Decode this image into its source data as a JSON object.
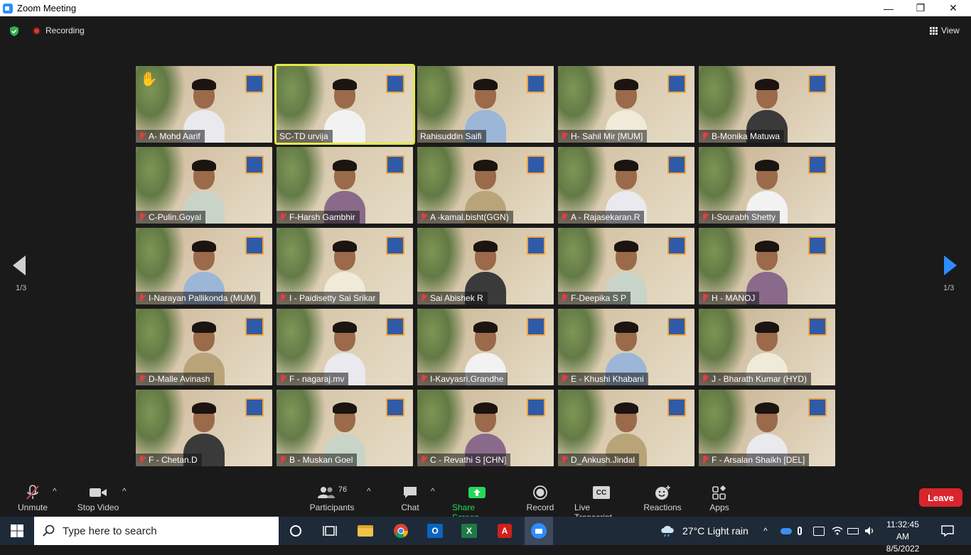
{
  "window": {
    "title": "Zoom Meeting",
    "minimize": "—",
    "restore": "❐",
    "close": "✕"
  },
  "meeting": {
    "recording_label": "Recording",
    "view_label": "View"
  },
  "pagination": {
    "left_page": "1/3",
    "right_page": "1/3"
  },
  "participants": [
    {
      "name": "A- Mohd Aarif",
      "muted": true,
      "raised_hand": true
    },
    {
      "name": "SC-TD urvija",
      "muted": false,
      "active_speaker": true
    },
    {
      "name": "Rahisuddin Saifi",
      "muted": false
    },
    {
      "name": "H- Sahil Mir [MUM]",
      "muted": true
    },
    {
      "name": "B-Monika Matuwa",
      "muted": true
    },
    {
      "name": "C-Pulin.Goyal",
      "muted": true
    },
    {
      "name": "F-Harsh Gambhir",
      "muted": true
    },
    {
      "name": "A -kamal.bisht(GGN)",
      "muted": true
    },
    {
      "name": "A - Rajasekaran.R",
      "muted": true
    },
    {
      "name": "I-Sourabh Shetty",
      "muted": true
    },
    {
      "name": "I-Narayan Pallikonda (MUM)",
      "muted": true
    },
    {
      "name": "I - Paidisetty Sai Srikar",
      "muted": true
    },
    {
      "name": "Sai Abishek R",
      "muted": true
    },
    {
      "name": "F-Deepika S P",
      "muted": true
    },
    {
      "name": "H - MANOJ",
      "muted": true
    },
    {
      "name": "D-Malle Avinash",
      "muted": true
    },
    {
      "name": "F - nagaraj.mv",
      "muted": true
    },
    {
      "name": "I-Kavyasri.Grandhe",
      "muted": true
    },
    {
      "name": "E - Khushi Khabani",
      "muted": true
    },
    {
      "name": "J - Bharath Kumar (HYD)",
      "muted": true
    },
    {
      "name": "F - Chetan.D",
      "muted": true
    },
    {
      "name": "B - Muskan Goel",
      "muted": true
    },
    {
      "name": "C - Revathi S [CHN]",
      "muted": true
    },
    {
      "name": "D_Ankush.Jindal",
      "muted": true
    },
    {
      "name": "F - Arsalan Shaikh [DEL]",
      "muted": true
    }
  ],
  "toolbar": {
    "unmute": "Unmute",
    "stop_video": "Stop Video",
    "participants": "Participants",
    "participants_count": "76",
    "chat": "Chat",
    "share_screen": "Share Screen",
    "record": "Record",
    "live_transcript": "Live Transcript",
    "reactions": "Reactions",
    "apps": "Apps",
    "leave": "Leave",
    "cc_label": "CC"
  },
  "taskbar": {
    "search_placeholder": "Type here to search",
    "weather": "27°C  Light rain",
    "time": "11:32:45 AM",
    "date": "8/5/2022"
  },
  "colors": {
    "accent": "#2d8cff",
    "leave": "#d9252c",
    "share": "#23d959",
    "active_outline": "#e3e84a"
  }
}
